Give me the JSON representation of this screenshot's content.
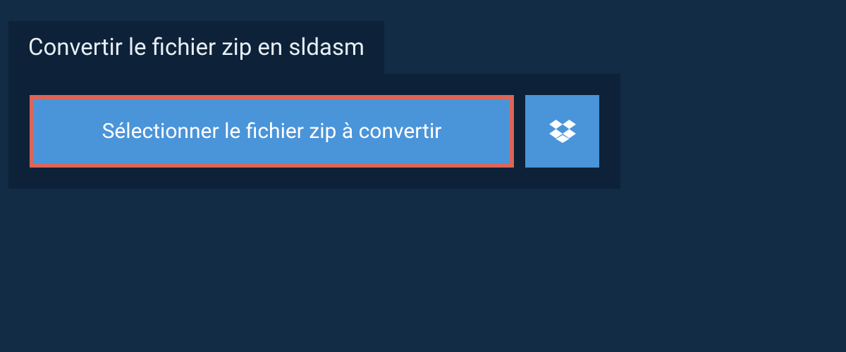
{
  "tab": {
    "label": "Convertir le fichier zip en sldasm"
  },
  "selectButton": {
    "label": "Sélectionner le fichier zip à convertir"
  },
  "colors": {
    "pageBg": "#122c46",
    "panelBg": "#0d2238",
    "buttonBg": "#4a94da",
    "highlightBorder": "#dc6557",
    "text": "#e8eef5"
  }
}
